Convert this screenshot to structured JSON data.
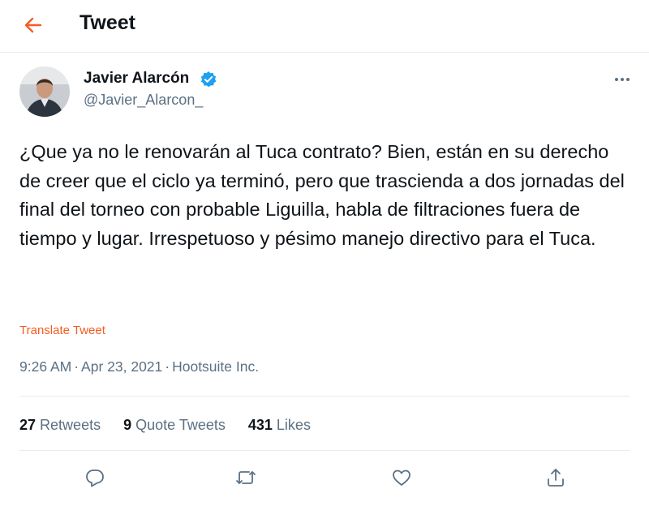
{
  "header": {
    "title": "Tweet"
  },
  "author": {
    "name": "Javier Alarcón",
    "handle": "@Javier_Alarcon_",
    "verified": true
  },
  "tweet": {
    "text": "¿Que ya no le renovarán al Tuca contrato? Bien, están en su derecho de creer que el ciclo ya terminó, pero que trascienda a dos jornadas del final del torneo con probable Liguilla, habla de filtraciones fuera de tiempo y lugar. Irrespetuoso y pésimo manejo directivo para el Tuca.",
    "translate_label": "Translate Tweet",
    "time": "9:26 AM",
    "date": "Apr 23, 2021",
    "source": "Hootsuite Inc."
  },
  "stats": {
    "retweets_count": "27",
    "retweets_label": "Retweets",
    "quotes_count": "9",
    "quotes_label": "Quote Tweets",
    "likes_count": "431",
    "likes_label": "Likes"
  },
  "colors": {
    "accent": "#f45d22",
    "verified": "#1da1f2",
    "muted": "#5b7083",
    "text": "#0f1419"
  },
  "icons": {
    "back": "arrow-left-icon",
    "verified": "verified-badge-icon",
    "more": "more-dots-icon",
    "reply": "reply-icon",
    "retweet": "retweet-icon",
    "like": "heart-icon",
    "share": "share-icon"
  }
}
